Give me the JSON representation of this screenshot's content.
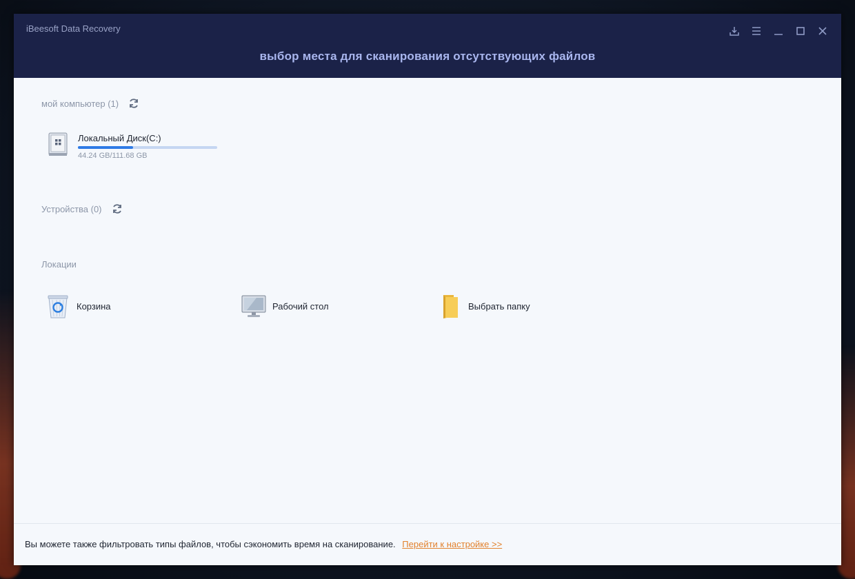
{
  "window": {
    "app_name": "iBeesoft Data Recovery",
    "heading": "выбор места для сканирования отсутствующих файлов",
    "controls": [
      "download-icon",
      "menu-icon",
      "minimize-icon",
      "maximize-icon",
      "close-icon"
    ]
  },
  "sections": {
    "computer": {
      "label": "мой компьютер (1)"
    },
    "devices": {
      "label": "Устройства (0)"
    },
    "locations": {
      "label": "Локации"
    }
  },
  "drives": [
    {
      "name": "Локальный Диск(C:)",
      "size": "44.24 GB/111.68 GB",
      "used_fraction": 0.396
    }
  ],
  "locations": [
    {
      "label": "Корзина",
      "icon": "recycle-bin-icon"
    },
    {
      "label": "Рабочий стол",
      "icon": "desktop-monitor-icon"
    },
    {
      "label": "Выбрать папку",
      "icon": "folder-icon"
    }
  ],
  "footer": {
    "text": "Вы можете также фильтровать типы файлов, чтобы сэкономить время на сканирование.",
    "link": "Перейти к настройке >>"
  },
  "colors": {
    "titlebar": "#1b2248",
    "heading": "#a9b6ee",
    "progress": "#2f7be6",
    "link": "#e2822d",
    "content_bg": "#f5f8fc"
  }
}
